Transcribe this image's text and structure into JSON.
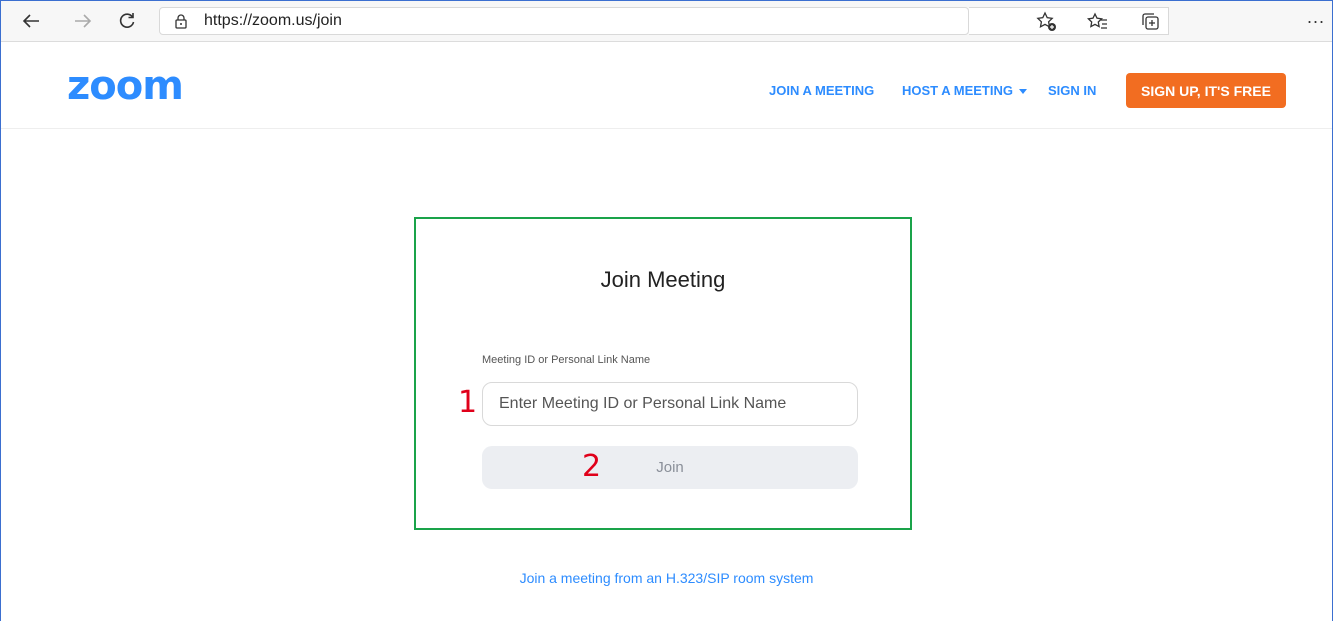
{
  "browser": {
    "url": "https://zoom.us/join",
    "more": "..."
  },
  "header": {
    "logo": "zoom",
    "nav": {
      "join_meeting": "JOIN A MEETING",
      "host_meeting": "HOST A MEETING",
      "sign_in": "SIGN IN",
      "sign_up": "SIGN UP, IT'S FREE"
    }
  },
  "join": {
    "title": "Join Meeting",
    "field_label": "Meeting ID or Personal Link Name",
    "placeholder": "Enter Meeting ID or Personal Link Name",
    "button_label": "Join",
    "marker_1": "1",
    "marker_2": "2"
  },
  "footer": {
    "h323_link": "Join a meeting from an H.323/SIP room system"
  },
  "colors": {
    "brand_blue": "#2d8cff",
    "signup_orange": "#f26d21",
    "card_border": "#1aa34a",
    "marker_red": "#e0001a"
  }
}
